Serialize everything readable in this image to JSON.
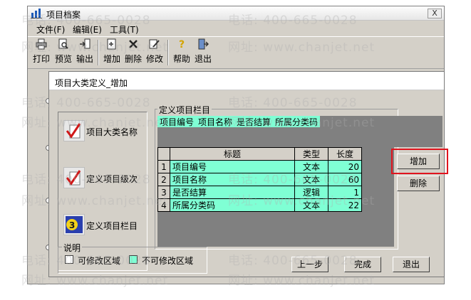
{
  "window": {
    "title": "项目档案",
    "close": "X",
    "menu": [
      "文件(F)",
      "编辑(E)",
      "工具(T)"
    ],
    "toolbar": [
      "打印",
      "预览",
      "输出",
      "增加",
      "删除",
      "修改",
      "帮助",
      "退出"
    ]
  },
  "dialog": {
    "title": "项目大类定义_增加",
    "steps": [
      "项目大类名称",
      "定义项目级次",
      "定义项目栏目"
    ],
    "group_title": "定义项目栏目",
    "field_strip": [
      "项目编号",
      "项目名称",
      "是否结算",
      "所属分类码"
    ],
    "table": {
      "headers": [
        "标题",
        "类型",
        "长度"
      ],
      "rows": [
        {
          "n": "1",
          "title": "项目编号",
          "type": "文本",
          "len": "20"
        },
        {
          "n": "2",
          "title": "项目名称",
          "type": "文本",
          "len": "60"
        },
        {
          "n": "3",
          "title": "是否结算",
          "type": "逻辑",
          "len": "1"
        },
        {
          "n": "4",
          "title": "所属分类码",
          "type": "文本",
          "len": "22"
        }
      ]
    },
    "buttons": {
      "add": "增加",
      "delete": "删除",
      "prev": "上一步",
      "finish": "完成",
      "exit": "退出"
    },
    "legend": {
      "title": "说明",
      "editable": "可修改区域",
      "readonly": "不可修改区域"
    }
  },
  "watermark": {
    "phone": "电话: 400-665-0028",
    "site": "网址: www.chanjet.net"
  },
  "colors": {
    "editable": "#ffffff",
    "readonly": "#7fffd4",
    "highlight": "#e0141e"
  }
}
